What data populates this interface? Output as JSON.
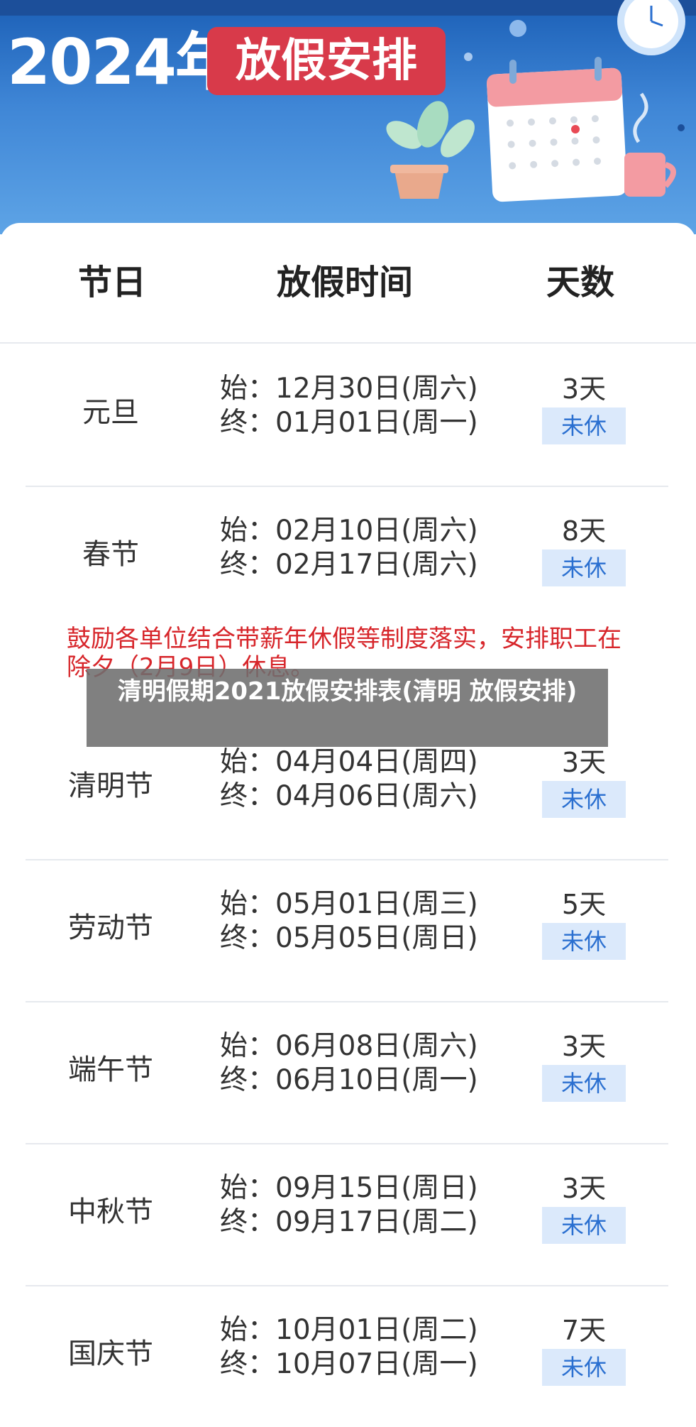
{
  "banner": {
    "year_label": "2024年",
    "tag_label": "放假安排"
  },
  "table": {
    "headers": {
      "festival": "节日",
      "time": "放假时间",
      "days": "天数"
    },
    "rows": [
      {
        "name": "元旦",
        "start": "始：12月30日(周六)",
        "end": "终：01月01日(周一)",
        "days": "3天",
        "tag": "未休"
      },
      {
        "name": "春节",
        "start": "始：02月10日(周六)",
        "end": "终：02月17日(周六)",
        "days": "8天",
        "tag": "未休"
      },
      {
        "name": "清明节",
        "start": "始：04月04日(周四)",
        "end": "终：04月06日(周六)",
        "days": "3天",
        "tag": "未休"
      },
      {
        "name": "劳动节",
        "start": "始：05月01日(周三)",
        "end": "终：05月05日(周日)",
        "days": "5天",
        "tag": "未休"
      },
      {
        "name": "端午节",
        "start": "始：06月08日(周六)",
        "end": "终：06月10日(周一)",
        "days": "3天",
        "tag": "未休"
      },
      {
        "name": "中秋节",
        "start": "始：09月15日(周日)",
        "end": "终：09月17日(周二)",
        "days": "3天",
        "tag": "未休"
      },
      {
        "name": "国庆节",
        "start": "始：10月01日(周二)",
        "end": "终：10月07日(周一)",
        "days": "7天",
        "tag": "未休"
      }
    ],
    "note": "鼓励各单位结合带薪年休假等制度落实，安排职工在除夕（2月9日）休息。"
  },
  "overlay": {
    "caption": "清明假期2021放假安排表(清明 放假安排)"
  },
  "colors": {
    "banner_blue": "#3f86d6",
    "tag_red": "#d83a4a",
    "note_red": "#d7262b",
    "badge_bg": "#dbe9fb",
    "badge_text": "#2a6fd0"
  }
}
